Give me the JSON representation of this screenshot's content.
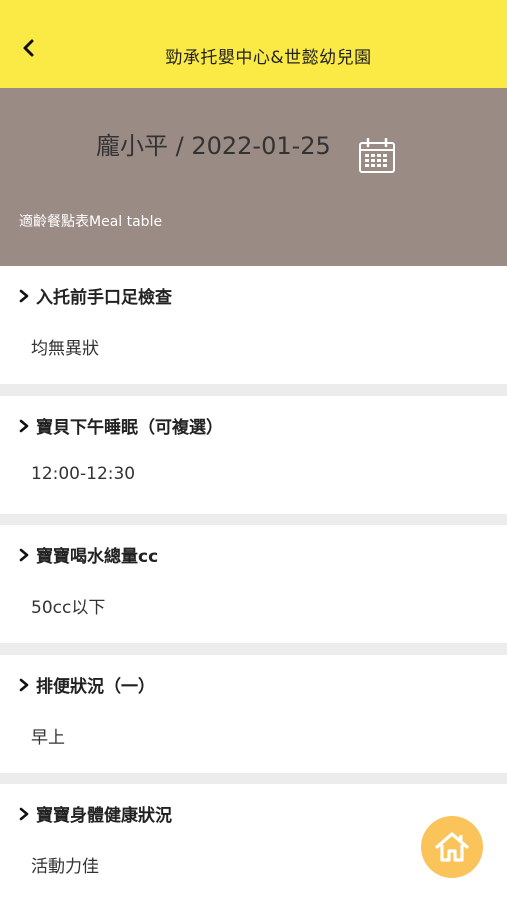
{
  "header": {
    "title": "勁承托嬰中心&世懿幼兒園",
    "back_icon": "chevron-left-icon"
  },
  "hero": {
    "name_date": "龐小平 / 2022-01-25",
    "subtitle": "適齡餐點表Meal table",
    "calendar_icon": "calendar-icon"
  },
  "sections": [
    {
      "title": "入托前手口足檢查",
      "value": "均無異狀"
    },
    {
      "title": "寶貝下午睡眠（可複選）",
      "value": "12:00-12:30"
    },
    {
      "title": "寶寶喝水總量cc",
      "value": "50cc以下"
    },
    {
      "title": "排便狀況（一）",
      "value": "早上"
    },
    {
      "title": "寶寶身體健康狀況",
      "value": "活動力佳"
    }
  ],
  "fab": {
    "icon": "home-icon"
  },
  "colors": {
    "header_bg": "#fbe945",
    "hero_bg": "#9a8b85",
    "fab_bg": "#fbc45a",
    "page_bg": "#ececec"
  }
}
